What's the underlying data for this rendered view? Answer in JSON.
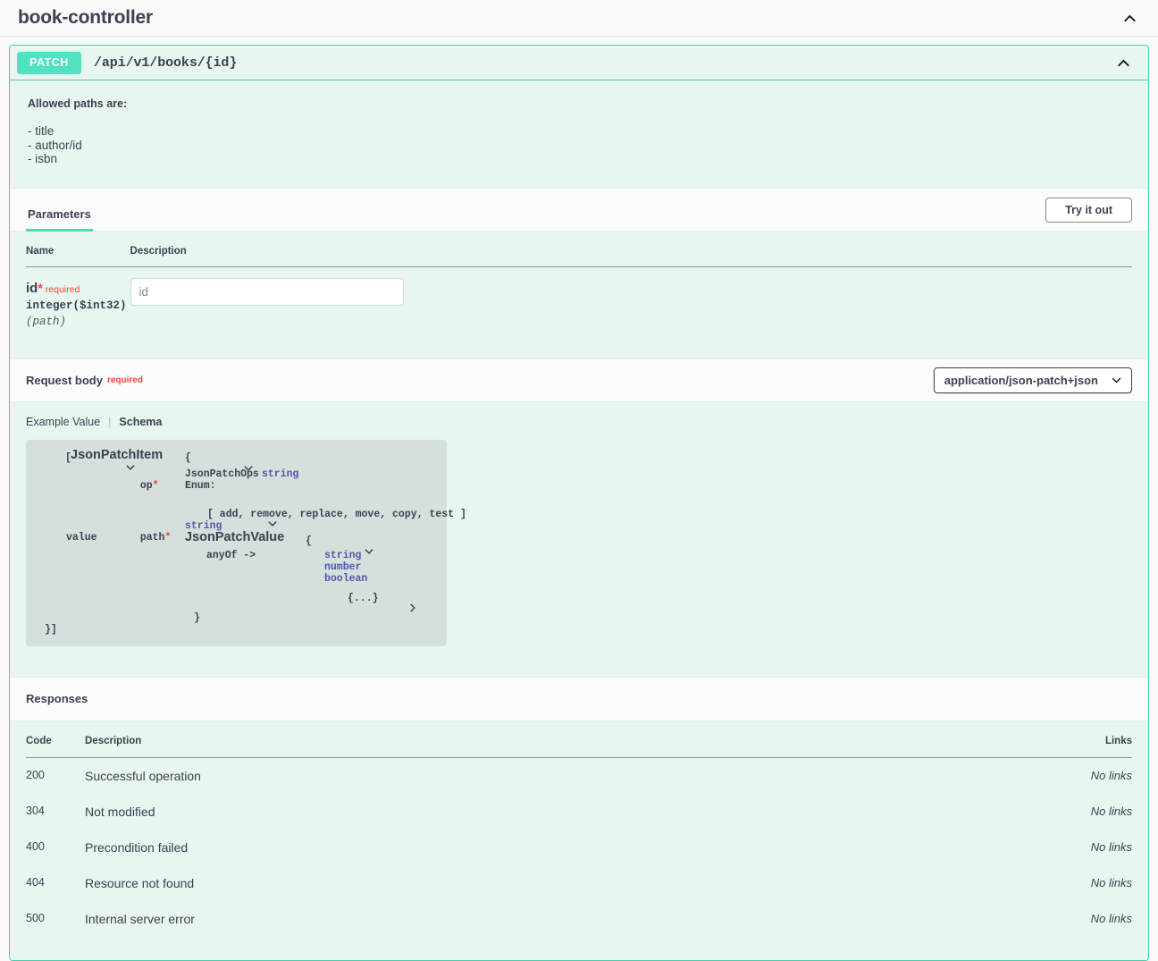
{
  "tag": {
    "title": "book-controller",
    "collapse_icon": "chevron-up-icon"
  },
  "operation": {
    "method": "PATCH",
    "path": "/api/v1/books/{id}",
    "collapse_icon": "chevron-up-icon",
    "description": {
      "heading": "Allowed paths are:",
      "lines": [
        "- title",
        "- author/id",
        "- isbn"
      ]
    }
  },
  "parameters_section": {
    "tab_label": "Parameters",
    "try_it_out_label": "Try it out",
    "columns": {
      "name": "Name",
      "description": "Description"
    },
    "rows": [
      {
        "name": "id",
        "required_star": "*",
        "required_label": "required",
        "type": "integer($int32)",
        "location": "(path)",
        "input_value": "",
        "input_placeholder": "id"
      }
    ]
  },
  "request_body": {
    "title": "Request body",
    "required_label": "required",
    "content_type": "application/json-patch+json",
    "content_type_icon": "chevron-down-icon",
    "tabs": {
      "example_value": "Example Value",
      "schema": "Schema",
      "active": "Schema"
    },
    "schema": {
      "array_open": "[",
      "model_name": "JsonPatchItem",
      "open_brace": "{",
      "props": [
        {
          "name": "op",
          "required": "*",
          "type_name": "JsonPatchOps",
          "type": "string",
          "enum_label": "Enum:",
          "enum_values": "[ add, remove, replace, move, copy, test ]",
          "enum_icon": "chevron-down-icon"
        },
        {
          "name": "path",
          "required": "*",
          "type": "string"
        },
        {
          "name": "value",
          "required": "",
          "model": "JsonPatchValue",
          "model_icon": "chevron-down-icon",
          "open_brace": "{",
          "anyof_label": "anyOf ->",
          "anyof_types": [
            "string",
            "number",
            "boolean"
          ],
          "collapsed_object": "{...}",
          "collapsed_icon": "chevron-right-icon",
          "close_brace": "}"
        }
      ],
      "array_close": "}]",
      "root_icon": "chevron-down-icon",
      "model_icon": "chevron-down-icon"
    }
  },
  "responses": {
    "title": "Responses",
    "columns": {
      "code": "Code",
      "description": "Description",
      "links": "Links"
    },
    "rows": [
      {
        "code": "200",
        "description": "Successful operation",
        "links": "No links"
      },
      {
        "code": "304",
        "description": "Not modified",
        "links": "No links"
      },
      {
        "code": "400",
        "description": "Precondition failed",
        "links": "No links"
      },
      {
        "code": "404",
        "description": "Resource not found",
        "links": "No links"
      },
      {
        "code": "500",
        "description": "Internal server error",
        "links": "No links"
      }
    ]
  },
  "colors": {
    "patch_badge": "#50e3c2",
    "block_border": "#49cfad",
    "block_bg": "#e8f6f0",
    "schema_bg": "#d5e0dc",
    "required_red": "#f93e3e",
    "type_blue": "#5555aa",
    "text": "#3b4151"
  }
}
